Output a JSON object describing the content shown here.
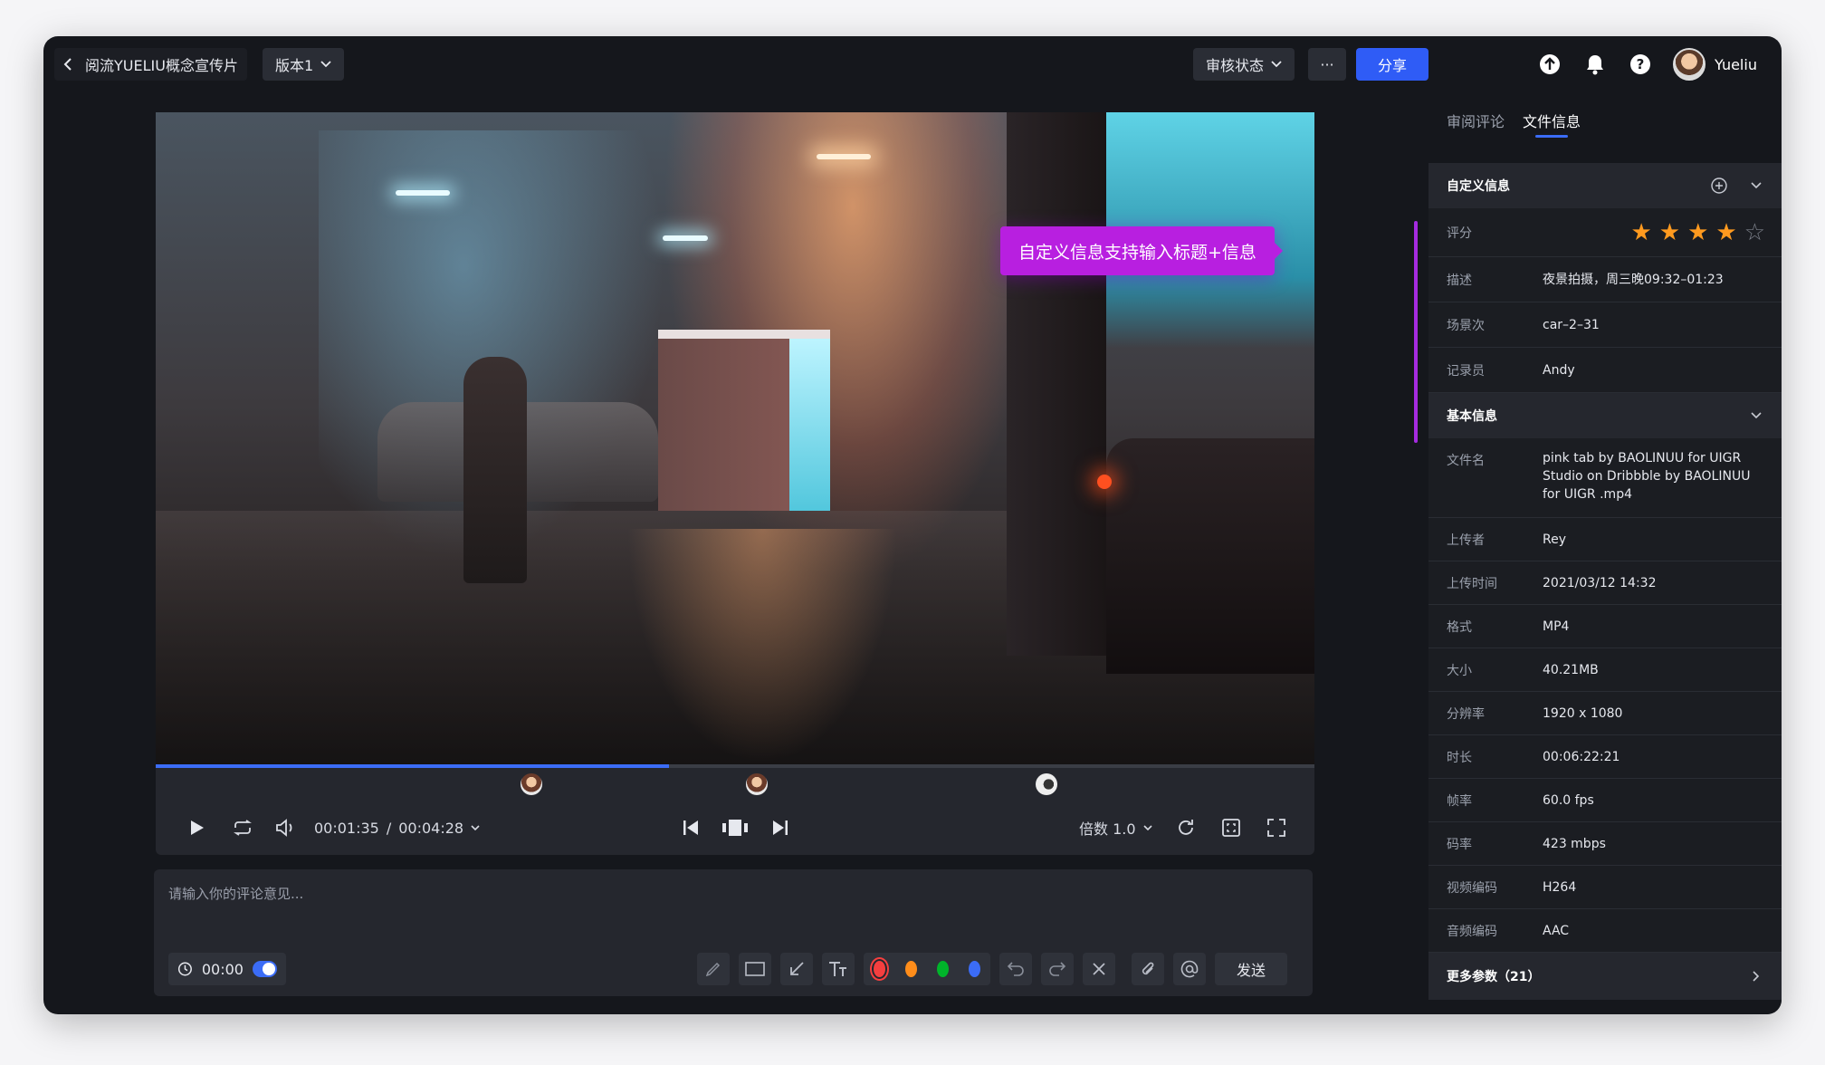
{
  "header": {
    "back_title": "阅流YUELIU概念宣传片",
    "version_label": "版本1",
    "review_label": "审核状态",
    "more_label": "···",
    "share_label": "分享",
    "username": "Yueliu"
  },
  "player": {
    "tooltip": "自定义信息支持输入标题+信息",
    "current_time": "00:01:35",
    "separator": "/",
    "total_time": "00:04:28",
    "speed_label": "倍数 1.0",
    "progress": 0.443
  },
  "comment": {
    "placeholder": "请输入你的评论意见...",
    "timestamp": "00:00",
    "send_label": "发送",
    "colors": [
      "#f53f3f",
      "#ff8d1a",
      "#00b42a",
      "#3b6cf6"
    ]
  },
  "panel": {
    "tabs": [
      "审阅评论",
      "文件信息"
    ],
    "custom": {
      "title": "自定义信息",
      "rating_label": "评分",
      "rating": 4,
      "rating_max": 5,
      "rows": [
        {
          "k": "描述",
          "v": "夜景拍摄，周三晚09:32–01:23"
        },
        {
          "k": "场景次",
          "v": "car–2–31"
        },
        {
          "k": "记录员",
          "v": "Andy"
        }
      ]
    },
    "basic": {
      "title": "基本信息",
      "filename_label": "文件名",
      "filename": "pink tab by BAOLINUU for UIGR Studio on Dribbble by BAOLINUU for UIGR .mp4",
      "rows": [
        {
          "k": "上传者",
          "v": "Rey"
        },
        {
          "k": "上传时间",
          "v": "2021/03/12 14:32"
        },
        {
          "k": "格式",
          "v": "MP4"
        },
        {
          "k": "大小",
          "v": "40.21MB"
        },
        {
          "k": "分辨率",
          "v": "1920 x 1080"
        },
        {
          "k": "时长",
          "v": "00:06:22:21"
        },
        {
          "k": "帧率",
          "v": "60.0 fps"
        },
        {
          "k": "码率",
          "v": "423 mbps"
        },
        {
          "k": "视频编码",
          "v": "H264"
        },
        {
          "k": "音频编码",
          "v": "AAC"
        }
      ]
    },
    "more_params": "更多参数（21）"
  }
}
